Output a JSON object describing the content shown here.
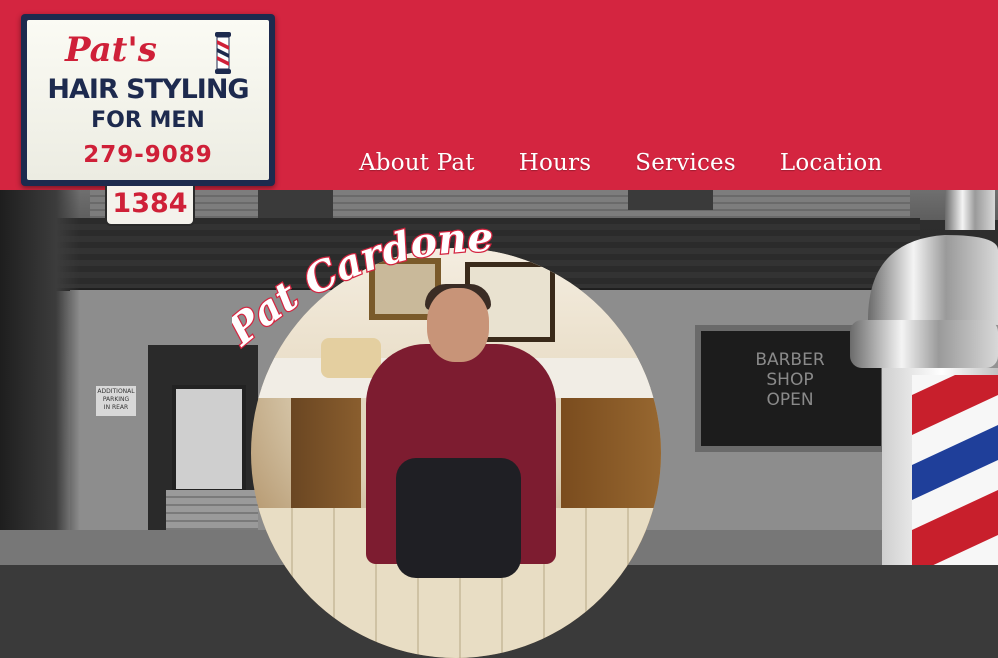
{
  "site": {
    "sign": {
      "script_name": "Pat's",
      "line1": "HAIR STYLING",
      "line2": "FOR MEN",
      "phone": "279-9089"
    },
    "address_number": "1384"
  },
  "nav": {
    "items": [
      {
        "label": "About Pat",
        "name": "nav-about-pat"
      },
      {
        "label": "Hours",
        "name": "nav-hours"
      },
      {
        "label": "Services",
        "name": "nav-services"
      },
      {
        "label": "Location",
        "name": "nav-location"
      }
    ]
  },
  "hero": {
    "portrait_caption": "Pat Cardone",
    "storefront_window_text": [
      "BARBER",
      "SHOP",
      "OPEN"
    ],
    "parking_sign": [
      "ADDITIONAL",
      "PARKING",
      "IN REAR"
    ]
  },
  "colors": {
    "header_red": "#d42540",
    "sign_navy": "#1d2a4e",
    "sign_red": "#cf2038",
    "nav_text": "#ffffff"
  }
}
